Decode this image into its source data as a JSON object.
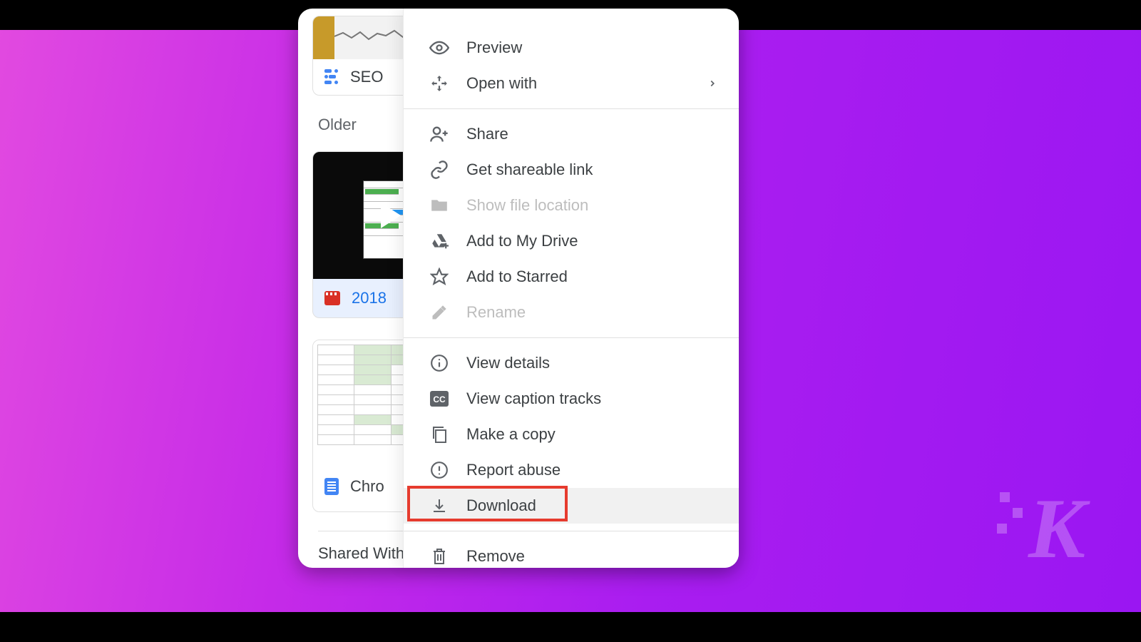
{
  "sections": {
    "older_label": "Older",
    "shared_label": "Shared With M"
  },
  "files": {
    "seo": {
      "title": "SEO "
    },
    "video": {
      "title": "2018"
    },
    "doc": {
      "title": "Chro"
    }
  },
  "menu": {
    "preview": "Preview",
    "open_with": "Open with",
    "share": "Share",
    "get_link": "Get shareable link",
    "show_location": "Show file location",
    "add_drive": "Add to My Drive",
    "add_starred": "Add to Starred",
    "rename": "Rename",
    "view_details": "View details",
    "caption_tracks": "View caption tracks",
    "make_copy": "Make a copy",
    "report_abuse": "Report abuse",
    "download": "Download",
    "remove": "Remove"
  },
  "watermark": "K"
}
